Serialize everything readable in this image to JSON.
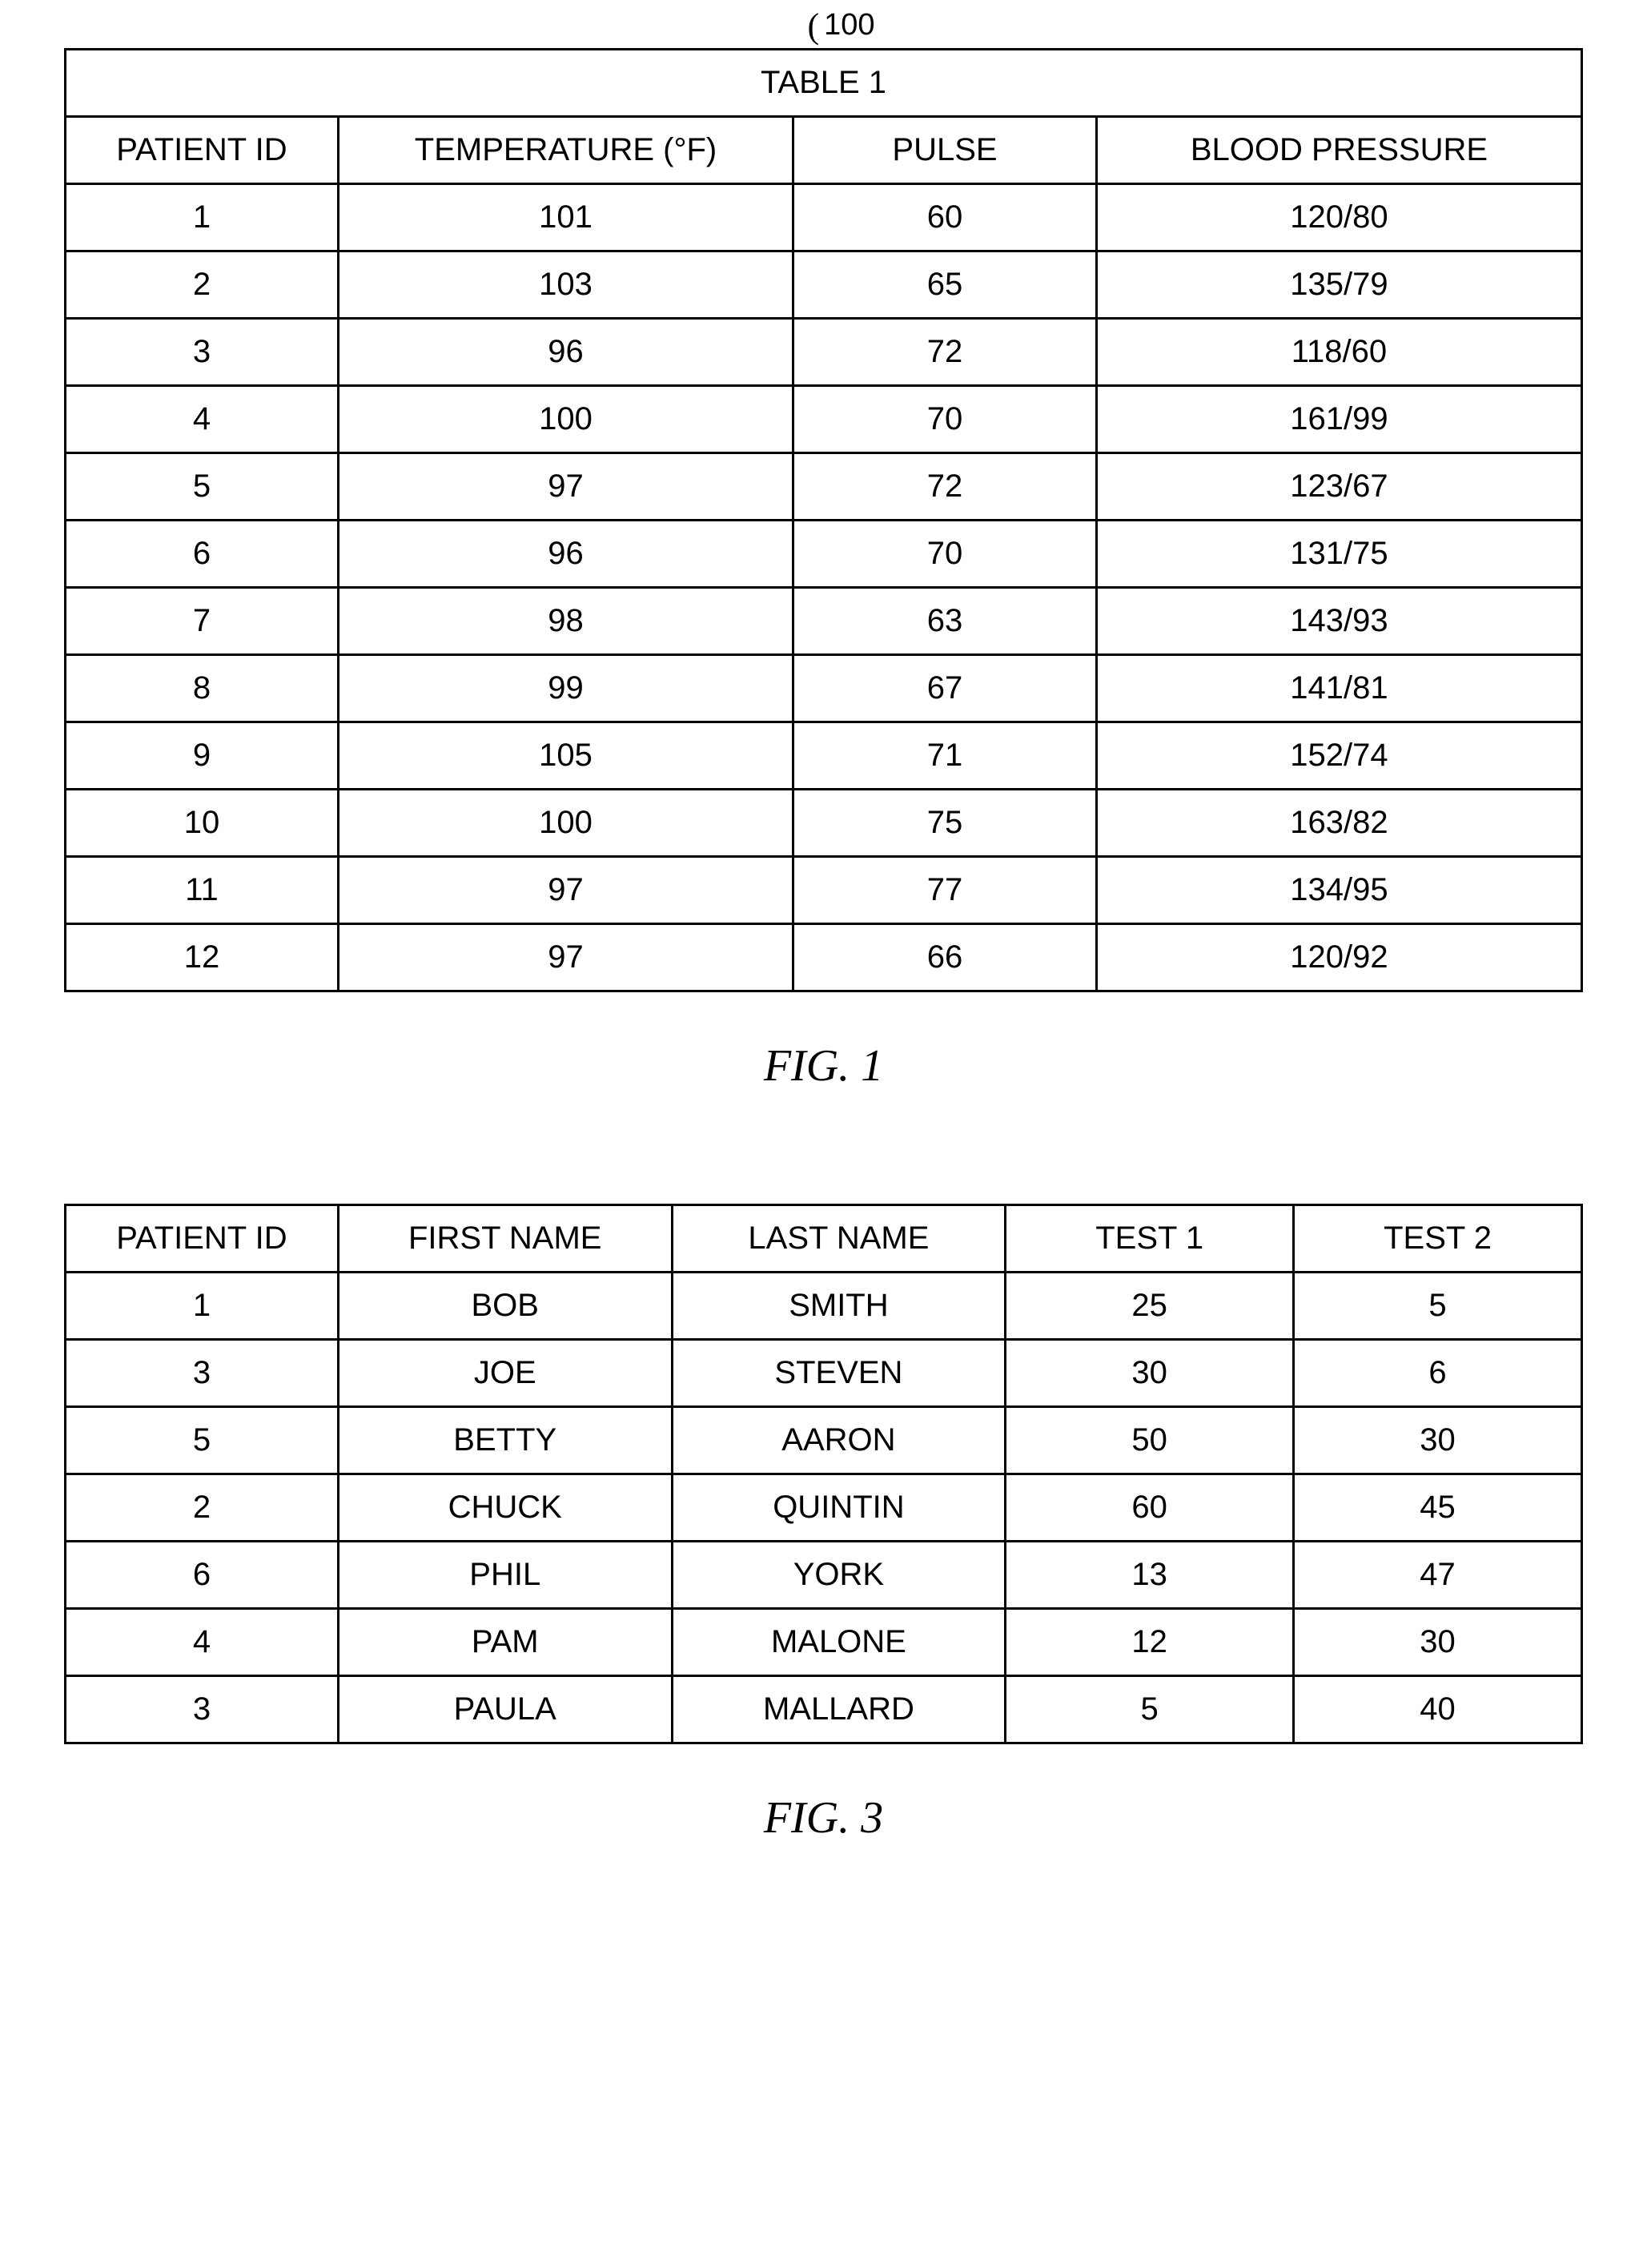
{
  "figure1": {
    "ref_number": "100",
    "title": "TABLE 1",
    "caption": "FIG. 1",
    "headers": [
      "PATIENT ID",
      "TEMPERATURE (°F)",
      "PULSE",
      "BLOOD PRESSURE"
    ],
    "rows": [
      [
        "1",
        "101",
        "60",
        "120/80"
      ],
      [
        "2",
        "103",
        "65",
        "135/79"
      ],
      [
        "3",
        "96",
        "72",
        "118/60"
      ],
      [
        "4",
        "100",
        "70",
        "161/99"
      ],
      [
        "5",
        "97",
        "72",
        "123/67"
      ],
      [
        "6",
        "96",
        "70",
        "131/75"
      ],
      [
        "7",
        "98",
        "63",
        "143/93"
      ],
      [
        "8",
        "99",
        "67",
        "141/81"
      ],
      [
        "9",
        "105",
        "71",
        "152/74"
      ],
      [
        "10",
        "100",
        "75",
        "163/82"
      ],
      [
        "11",
        "97",
        "77",
        "134/95"
      ],
      [
        "12",
        "97",
        "66",
        "120/92"
      ]
    ]
  },
  "figure3": {
    "caption": "FIG. 3",
    "headers": [
      "PATIENT ID",
      "FIRST NAME",
      "LAST NAME",
      "TEST 1",
      "TEST 2"
    ],
    "rows": [
      [
        "1",
        "BOB",
        "SMITH",
        "25",
        "5"
      ],
      [
        "3",
        "JOE",
        "STEVEN",
        "30",
        "6"
      ],
      [
        "5",
        "BETTY",
        "AARON",
        "50",
        "30"
      ],
      [
        "2",
        "CHUCK",
        "QUINTIN",
        "60",
        "45"
      ],
      [
        "6",
        "PHIL",
        "YORK",
        "13",
        "47"
      ],
      [
        "4",
        "PAM",
        "MALONE",
        "12",
        "30"
      ],
      [
        "3",
        "PAULA",
        "MALLARD",
        "5",
        "40"
      ]
    ]
  },
  "chart_data": [
    {
      "type": "table",
      "title": "TABLE 1",
      "columns": [
        "PATIENT ID",
        "TEMPERATURE (°F)",
        "PULSE",
        "BLOOD PRESSURE"
      ],
      "data": [
        {
          "patient_id": 1,
          "temperature_f": 101,
          "pulse": 60,
          "blood_pressure": "120/80"
        },
        {
          "patient_id": 2,
          "temperature_f": 103,
          "pulse": 65,
          "blood_pressure": "135/79"
        },
        {
          "patient_id": 3,
          "temperature_f": 96,
          "pulse": 72,
          "blood_pressure": "118/60"
        },
        {
          "patient_id": 4,
          "temperature_f": 100,
          "pulse": 70,
          "blood_pressure": "161/99"
        },
        {
          "patient_id": 5,
          "temperature_f": 97,
          "pulse": 72,
          "blood_pressure": "123/67"
        },
        {
          "patient_id": 6,
          "temperature_f": 96,
          "pulse": 70,
          "blood_pressure": "131/75"
        },
        {
          "patient_id": 7,
          "temperature_f": 98,
          "pulse": 63,
          "blood_pressure": "143/93"
        },
        {
          "patient_id": 8,
          "temperature_f": 99,
          "pulse": 67,
          "blood_pressure": "141/81"
        },
        {
          "patient_id": 9,
          "temperature_f": 105,
          "pulse": 71,
          "blood_pressure": "152/74"
        },
        {
          "patient_id": 10,
          "temperature_f": 100,
          "pulse": 75,
          "blood_pressure": "163/82"
        },
        {
          "patient_id": 11,
          "temperature_f": 97,
          "pulse": 77,
          "blood_pressure": "134/95"
        },
        {
          "patient_id": 12,
          "temperature_f": 97,
          "pulse": 66,
          "blood_pressure": "120/92"
        }
      ]
    },
    {
      "type": "table",
      "title": "FIG. 3",
      "columns": [
        "PATIENT ID",
        "FIRST NAME",
        "LAST NAME",
        "TEST 1",
        "TEST 2"
      ],
      "data": [
        {
          "patient_id": 1,
          "first_name": "BOB",
          "last_name": "SMITH",
          "test_1": 25,
          "test_2": 5
        },
        {
          "patient_id": 3,
          "first_name": "JOE",
          "last_name": "STEVEN",
          "test_1": 30,
          "test_2": 6
        },
        {
          "patient_id": 5,
          "first_name": "BETTY",
          "last_name": "AARON",
          "test_1": 50,
          "test_2": 30
        },
        {
          "patient_id": 2,
          "first_name": "CHUCK",
          "last_name": "QUINTIN",
          "test_1": 60,
          "test_2": 45
        },
        {
          "patient_id": 6,
          "first_name": "PHIL",
          "last_name": "YORK",
          "test_1": 13,
          "test_2": 47
        },
        {
          "patient_id": 4,
          "first_name": "PAM",
          "last_name": "MALONE",
          "test_1": 12,
          "test_2": 30
        },
        {
          "patient_id": 3,
          "first_name": "PAULA",
          "last_name": "MALLARD",
          "test_1": 5,
          "test_2": 40
        }
      ]
    }
  ]
}
